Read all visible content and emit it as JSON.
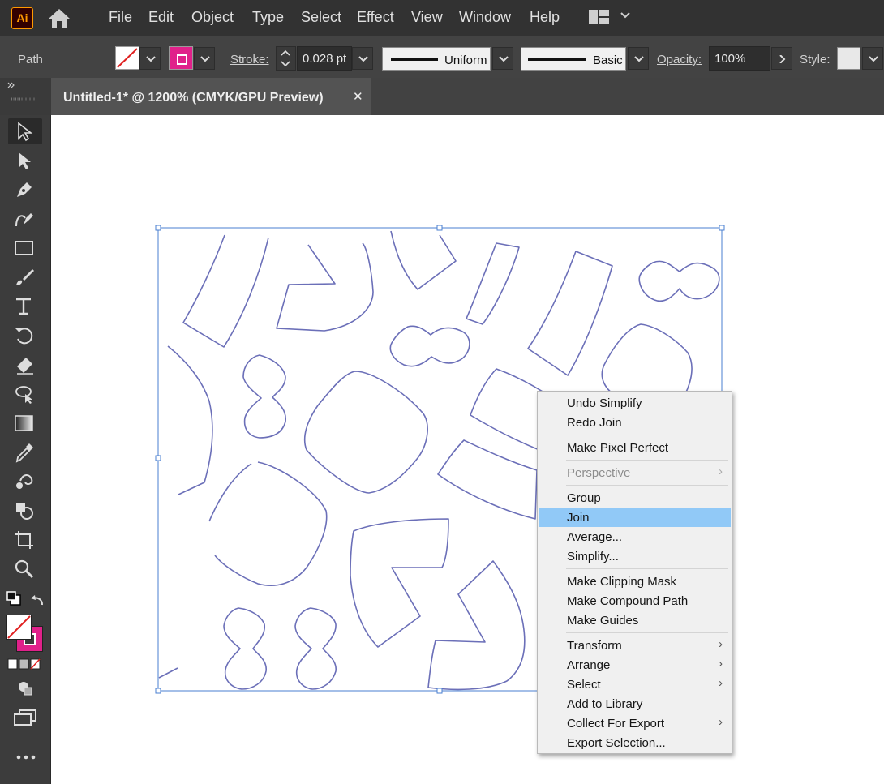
{
  "app": {
    "logo_text": "Ai"
  },
  "menubar": {
    "items": [
      "File",
      "Edit",
      "Object",
      "Type",
      "Select",
      "Effect",
      "View",
      "Window",
      "Help"
    ]
  },
  "controlbar": {
    "selection_type": "Path",
    "stroke_label": "Stroke:",
    "stroke_weight": "0.028 pt",
    "variable_width_profile": "Uniform",
    "brush_definition": "Basic",
    "opacity_label": "Opacity:",
    "opacity_value": "100%",
    "style_label": "Style:",
    "stroke_color": "#e0218a"
  },
  "document": {
    "tab_title": "Untitled-1* @ 1200% (CMYK/GPU Preview)",
    "close_glyph": "✕"
  },
  "context_menu": {
    "items": [
      {
        "label": "Undo Simplify"
      },
      {
        "label": "Redo Join"
      },
      {
        "label": "Make Pixel Perfect"
      },
      {
        "label": "Perspective",
        "disabled": true,
        "submenu": true
      },
      {
        "label": "Group"
      },
      {
        "label": "Join",
        "highlighted": true
      },
      {
        "label": "Average..."
      },
      {
        "label": "Simplify..."
      },
      {
        "label": "Make Clipping Mask"
      },
      {
        "label": "Make Compound Path"
      },
      {
        "label": "Make Guides"
      },
      {
        "label": "Transform",
        "submenu": true
      },
      {
        "label": "Arrange",
        "submenu": true
      },
      {
        "label": "Select",
        "submenu": true
      },
      {
        "label": "Add to Library"
      },
      {
        "label": "Collect For Export",
        "submenu": true
      },
      {
        "label": "Export Selection..."
      }
    ]
  },
  "colors": {
    "path_stroke": "#6b6fb8",
    "selection": "#4a7fd0",
    "highlight": "#91c9f7"
  }
}
